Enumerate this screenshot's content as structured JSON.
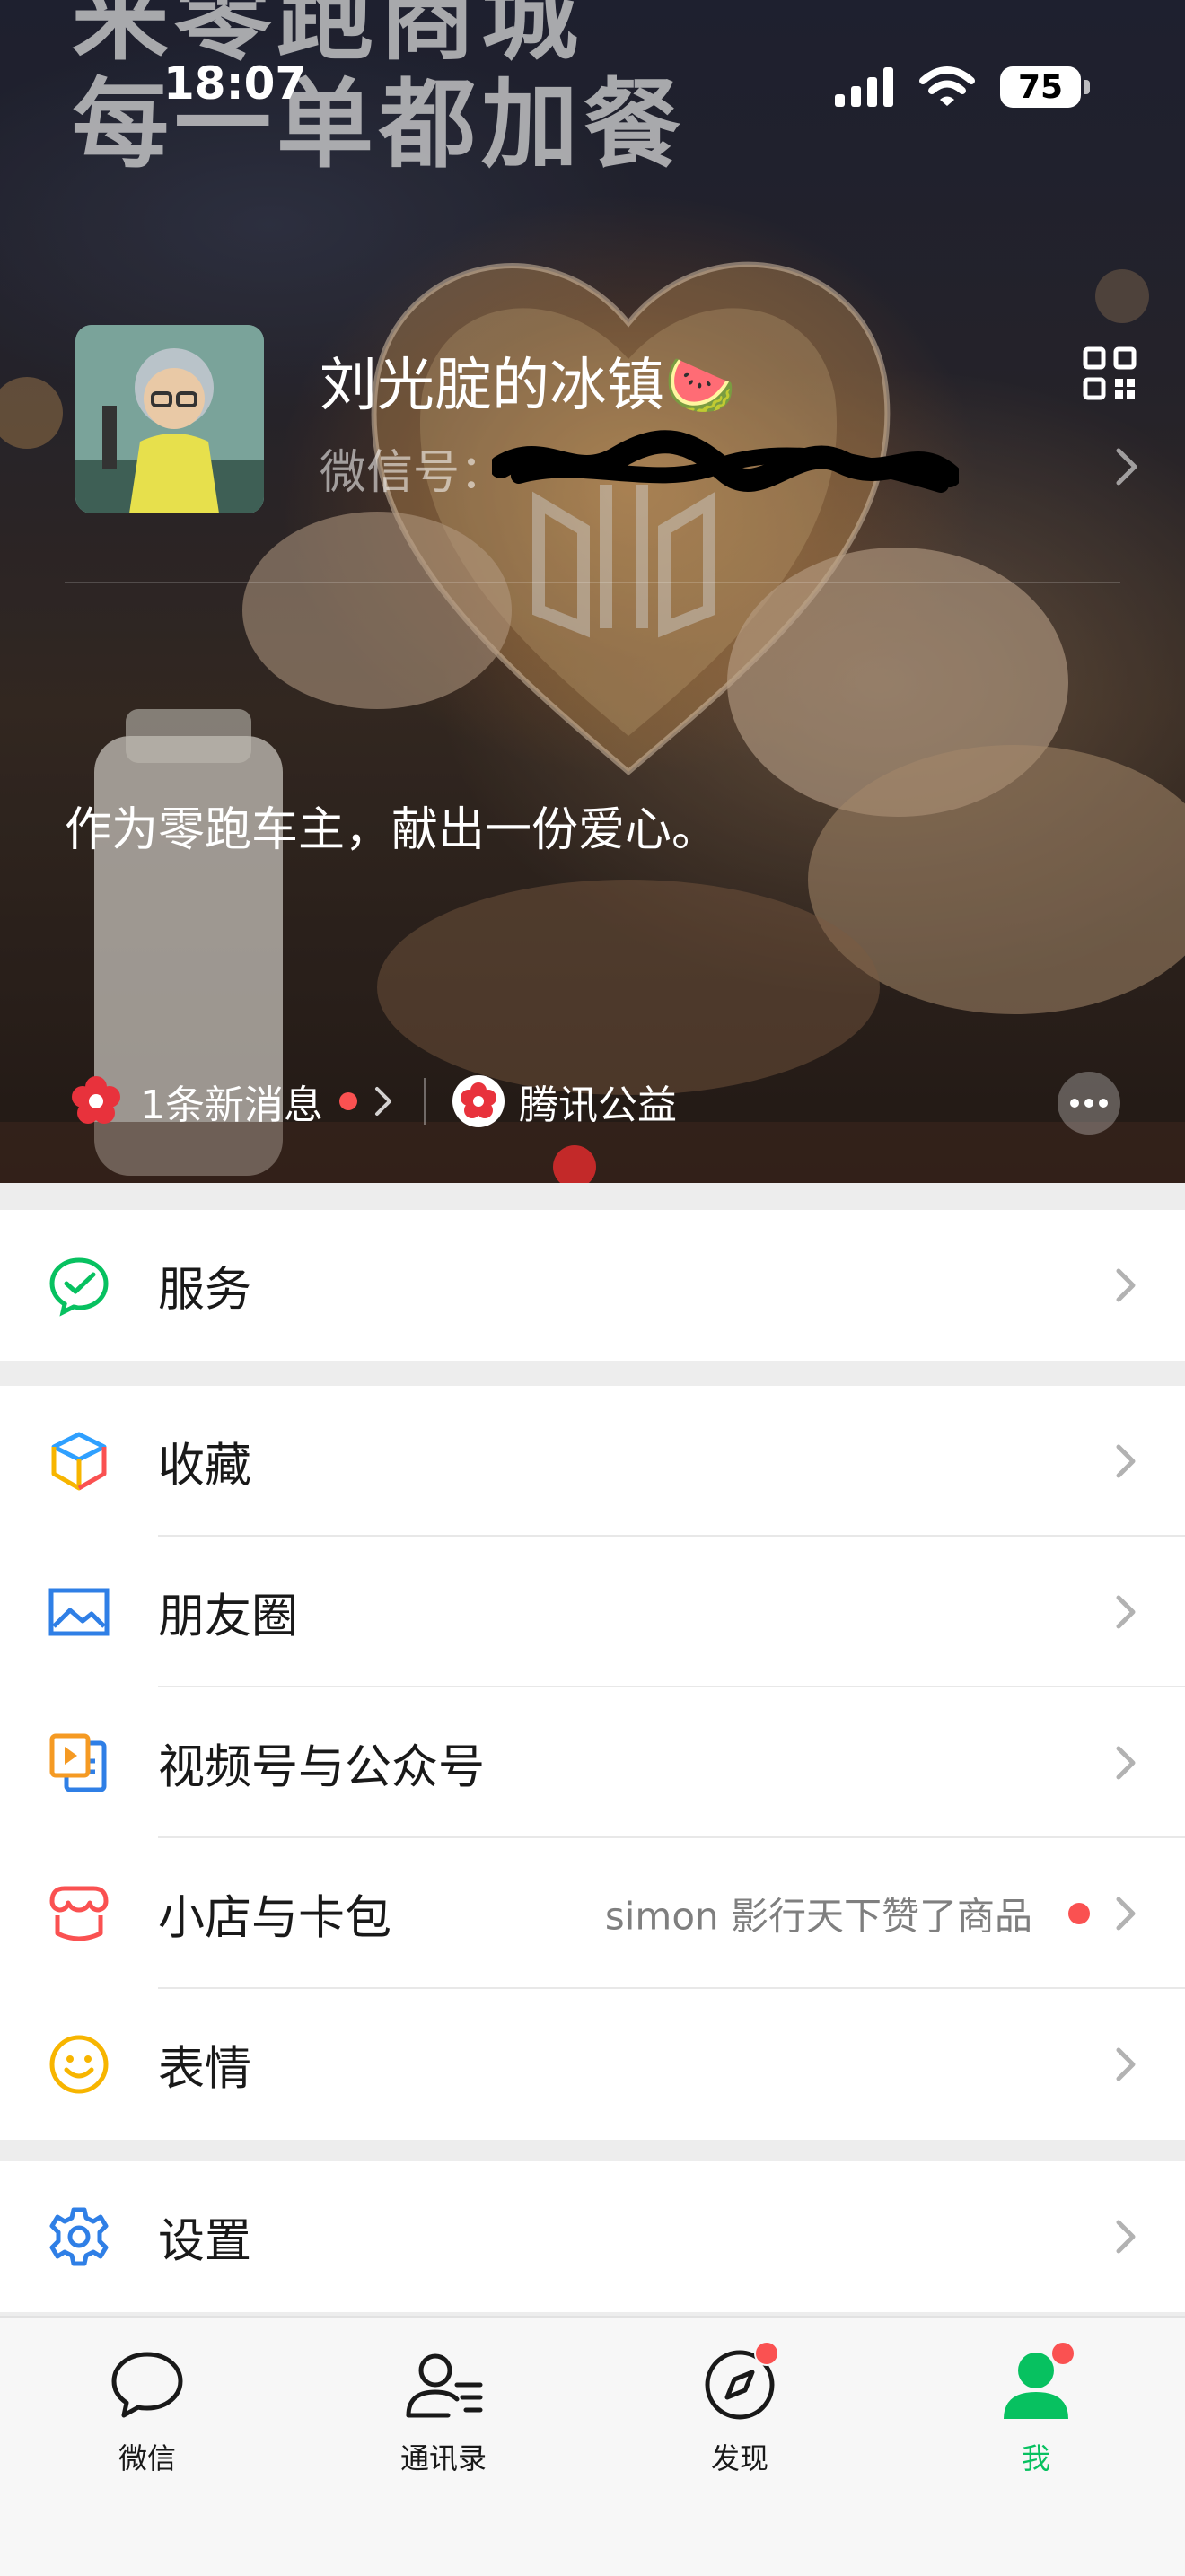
{
  "status_bar": {
    "time": "18:07",
    "battery": "75"
  },
  "hero": {
    "background_text": "来零跑商城\n每一单都加餐",
    "nickname": "刘光腚的冰镇🍉",
    "wxid_label": "微信号：",
    "status_text": "作为零跑车主，献出一份爱心。",
    "new_messages": "1条新消息",
    "charity": "腾讯公益"
  },
  "menu": {
    "services": "服务",
    "favorites": "收藏",
    "moments": "朋友圈",
    "channels": "视频号与公众号",
    "shop": "小店与卡包",
    "shop_notice": "simon 影行天下赞了商品",
    "stickers": "表情",
    "settings": "设置"
  },
  "tabs": [
    {
      "label": "微信",
      "icon": "chat-bubble-icon"
    },
    {
      "label": "通讯录",
      "icon": "contacts-icon"
    },
    {
      "label": "发现",
      "icon": "compass-icon"
    },
    {
      "label": "我",
      "icon": "person-icon"
    }
  ],
  "colors": {
    "accent": "#07c160",
    "badge": "#fa5151",
    "bg": "#ededed"
  }
}
